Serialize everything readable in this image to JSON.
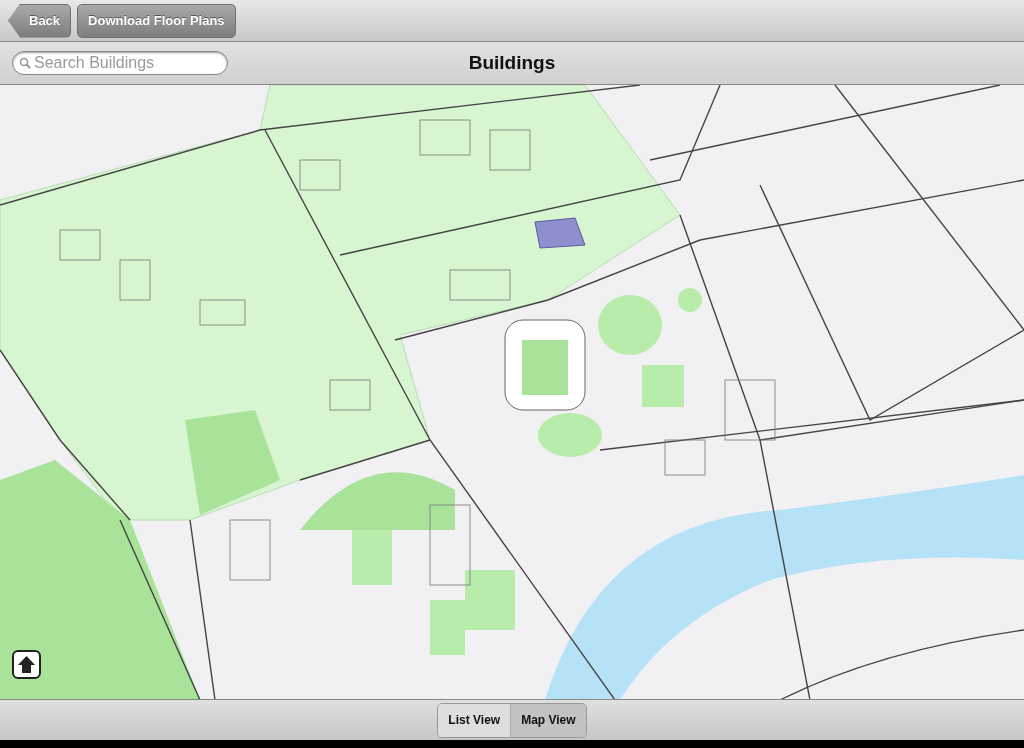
{
  "nav_bar": {
    "back_button": "Back",
    "download_button": "Download Floor Plans"
  },
  "search": {
    "placeholder": "Search Buildings"
  },
  "title": "Buildings",
  "view_switch": [
    {
      "label": "List View",
      "selected": false
    },
    {
      "label": "Map View",
      "selected": true
    }
  ]
}
